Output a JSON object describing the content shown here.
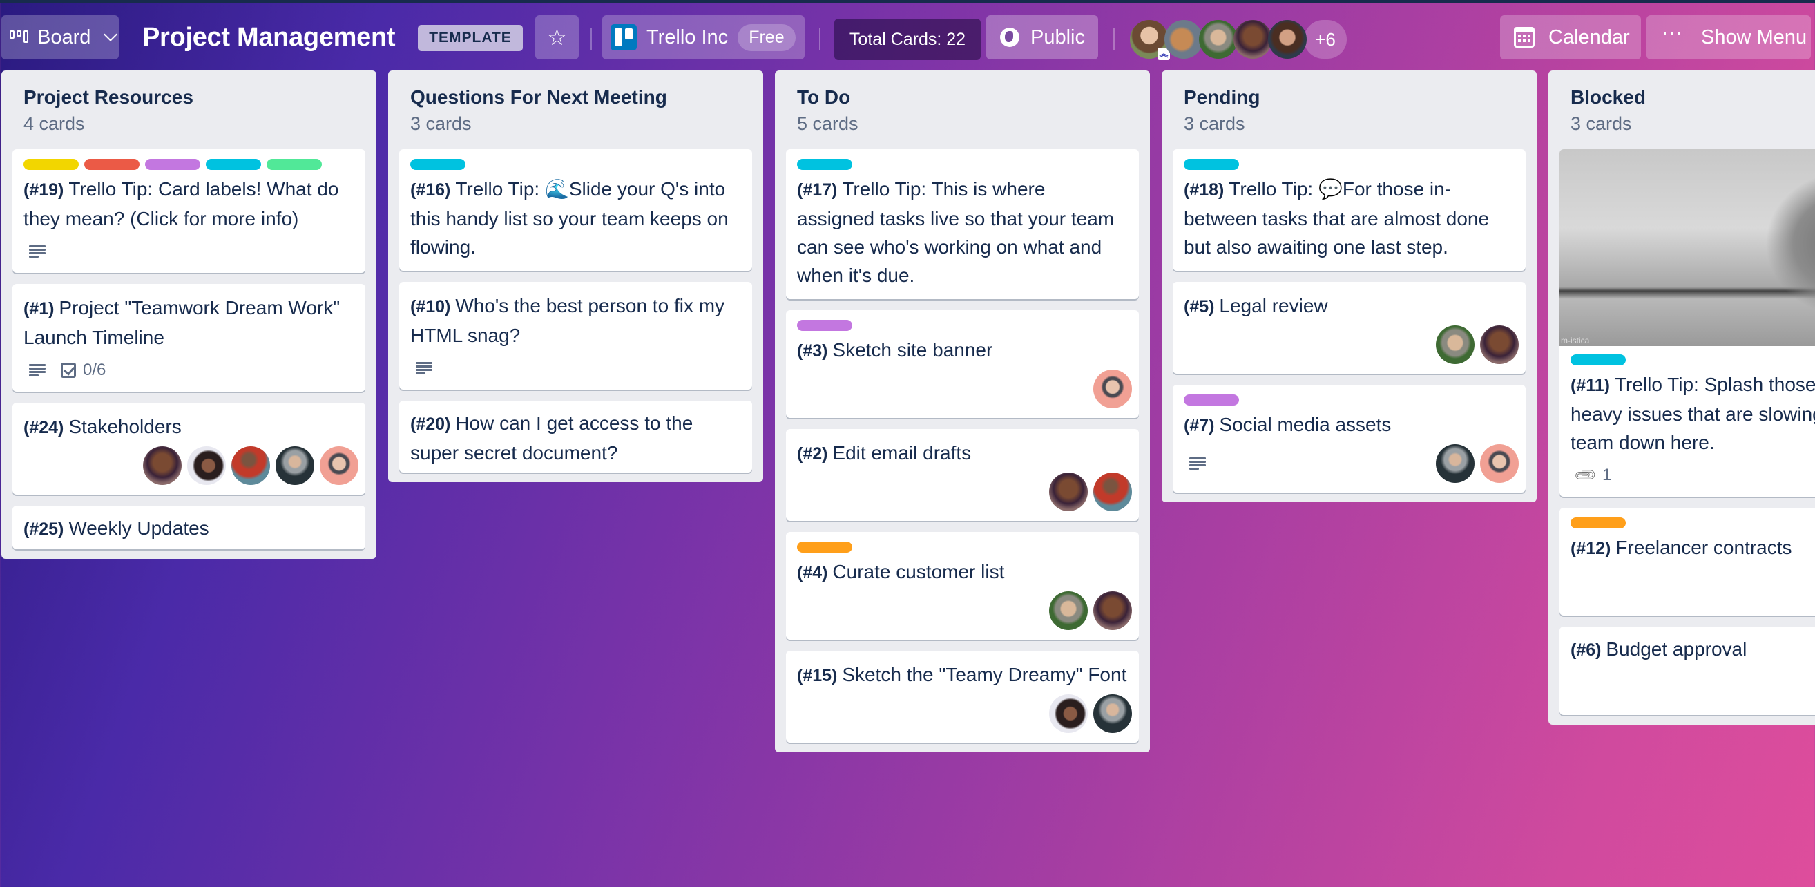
{
  "header": {
    "view_button": {
      "label": "Board",
      "icon": "board-icon"
    },
    "board_title": "Project Management",
    "template_badge": "TEMPLATE",
    "star_icon": "star-icon",
    "workspace": {
      "name": "Trello Inc",
      "plan": "Free",
      "icon": "trello-logo-icon"
    },
    "total_cards": "Total Cards: 22",
    "visibility": {
      "label": "Public",
      "icon": "globe-icon"
    },
    "members": [
      "girl",
      "horse",
      "woman",
      "man1",
      "beard"
    ],
    "more_members": "+6",
    "calendar": {
      "label": "Calendar",
      "icon": "calendar-icon"
    },
    "show_menu": {
      "label": "Show Menu",
      "icon": "ellipsis-icon"
    }
  },
  "colors": {
    "label_yellow": "#f2d600",
    "label_red": "#eb5a46",
    "label_purple": "#c377e0",
    "label_sky": "#00c2e0",
    "label_green": "#51e898",
    "label_orange": "#ff9f1a",
    "list_bg": "#ebecf0",
    "text": "#172b4d",
    "subtext": "#5e6c84"
  },
  "lists": [
    {
      "title": "Project Resources",
      "count": "4 cards",
      "cards": [
        {
          "num": "(#19)",
          "title": "Trello Tip: Card labels! What do they mean? (Click for more info)",
          "labels": [
            "label_yellow",
            "label_red",
            "label_purple",
            "label_sky",
            "label_green"
          ],
          "description": true,
          "members": []
        },
        {
          "num": "(#1)",
          "title": "Project \"Teamwork Dream Work\" Launch Timeline",
          "labels": [],
          "description": true,
          "checklist": "0/6",
          "members": []
        },
        {
          "num": "(#24)",
          "title": "Stakeholders",
          "labels": [],
          "members": [
            "man1",
            "afro",
            "plaid",
            "jacket",
            "pink"
          ]
        },
        {
          "num": "(#25)",
          "title": "Weekly Updates",
          "labels": [],
          "members": []
        }
      ]
    },
    {
      "title": "Questions For Next Meeting",
      "count": "3 cards",
      "cards": [
        {
          "num": "(#16)",
          "title": "Trello Tip: 🌊Slide your Q's into this handy list so your team keeps on flowing.",
          "labels": [
            "label_sky"
          ],
          "members": []
        },
        {
          "num": "(#10)",
          "title": "Who's the best person to fix my HTML snag?",
          "labels": [],
          "description": true,
          "members": []
        },
        {
          "num": "(#20)",
          "title": "How can I get access to the super secret document?",
          "labels": [],
          "members": []
        }
      ]
    },
    {
      "title": "To Do",
      "count": "5 cards",
      "cards": [
        {
          "num": "(#17)",
          "title": "Trello Tip: This is where assigned tasks live so that your team can see who's working on what and when it's due.",
          "labels": [
            "label_sky"
          ],
          "members": []
        },
        {
          "num": "(#3)",
          "title": "Sketch site banner",
          "labels": [
            "label_purple"
          ],
          "members": [
            "pink"
          ]
        },
        {
          "num": "(#2)",
          "title": "Edit email drafts",
          "labels": [],
          "members": [
            "man1",
            "plaid"
          ]
        },
        {
          "num": "(#4)",
          "title": "Curate customer list",
          "labels": [
            "label_orange"
          ],
          "members": [
            "woman",
            "man1"
          ]
        },
        {
          "num": "(#15)",
          "title": "Sketch the \"Teamy Dreamy\" Font",
          "labels": [],
          "members": [
            "afro",
            "jacket"
          ]
        }
      ]
    },
    {
      "title": "Pending",
      "count": "3 cards",
      "cards": [
        {
          "num": "(#18)",
          "title": "Trello Tip: 💬For those in-between tasks that are almost done but also awaiting one last step.",
          "labels": [
            "label_sky"
          ],
          "members": []
        },
        {
          "num": "(#5)",
          "title": "Legal review",
          "labels": [],
          "members": [
            "woman",
            "man1"
          ]
        },
        {
          "num": "(#7)",
          "title": "Social media assets",
          "labels": [
            "label_purple"
          ],
          "description": true,
          "members": [
            "jacket",
            "pink"
          ]
        }
      ]
    },
    {
      "title": "Blocked",
      "count": "3 cards",
      "cards": [
        {
          "num": "(#11)",
          "title": "Trello Tip: Splash those redtape-heavy issues that are slowing your team down here.",
          "labels": [
            "label_sky"
          ],
          "cover": "cat-gif-cover",
          "cover_watermark": "m-istica",
          "attachments": "1",
          "members": []
        },
        {
          "num": "(#12)",
          "title": "Freelancer contracts",
          "labels": [
            "label_orange"
          ],
          "members": [
            "woman"
          ]
        },
        {
          "num": "(#6)",
          "title": "Budget approval",
          "labels": [],
          "members": []
        }
      ]
    }
  ]
}
